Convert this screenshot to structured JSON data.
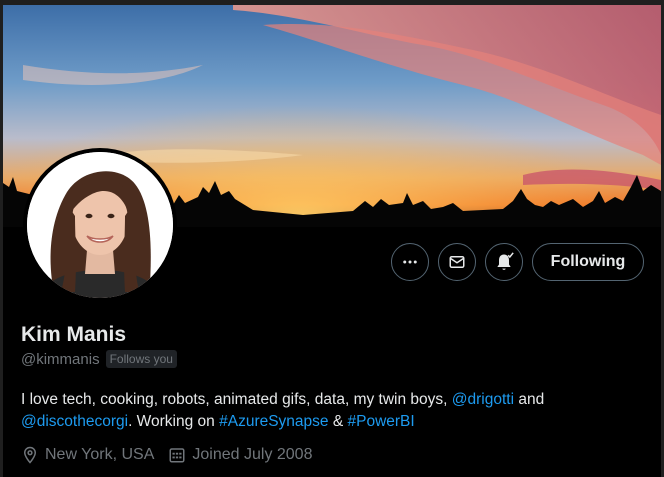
{
  "profile": {
    "name": "Kim Manis",
    "handle": "@kimmanis",
    "follows_badge": "Follows you",
    "bio": {
      "part1": "I love tech, cooking, robots, animated gifs, data, my twin boys, ",
      "mention1": "@drigotti",
      "part2": " and ",
      "mention2": "@discothecorgi",
      "part3": ". Working on ",
      "hashtag1": "#AzureSynapse",
      "part4": " & ",
      "hashtag2": "#PowerBI"
    },
    "location": "New York, USA",
    "joined": "Joined July 2008"
  },
  "actions": {
    "following_label": "Following"
  },
  "icons": {
    "more": "more-icon",
    "message": "mail-icon",
    "notifications": "bell-icon",
    "location": "location-pin-icon",
    "joined": "calendar-icon"
  },
  "colors": {
    "background": "#000000",
    "text": "#e7e9ea",
    "muted": "#71767b",
    "link": "#1d9bf0",
    "border": "#536471"
  }
}
